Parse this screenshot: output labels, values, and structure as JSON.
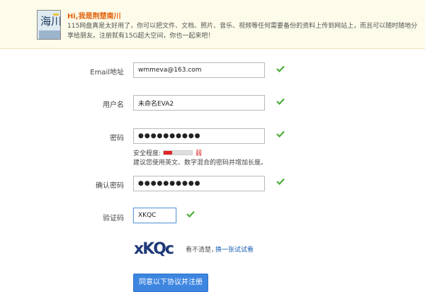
{
  "banner": {
    "title": "Hi,我是荆楚南川",
    "text": "115网盘真是太好用了，你可以把文件、文档、照片、音乐、视频等任何需要备份的资料上传到网站上，而且可以随时随地分享给朋友。注册就有15G超大空间，你也一起来吧！",
    "avatar_text": "海川"
  },
  "form": {
    "email": {
      "label": "Email地址",
      "value": "wmmeva@163.com"
    },
    "username": {
      "label": "用户名",
      "value": "未命名EVA2"
    },
    "password": {
      "label": "密码",
      "value": "●●●●●●●●●●"
    },
    "strength": {
      "label": "安全程度:",
      "word": "弱",
      "level": 0.3,
      "hint": "建议您使用英文、数字混合的密码并增加长度。"
    },
    "confirm": {
      "label": "确认密码",
      "value": "●●●●●●●●●●"
    },
    "captcha": {
      "label": "验证码",
      "value": "XKQC",
      "image_text": "xKQc",
      "question": "看不清楚，",
      "link": "换一张试试看"
    },
    "submit_label": "同意以下协议并注册"
  },
  "colors": {
    "check": "#4caf3a",
    "accent": "#3d86e0",
    "weak": "#e02424",
    "title": "#e2620c"
  }
}
